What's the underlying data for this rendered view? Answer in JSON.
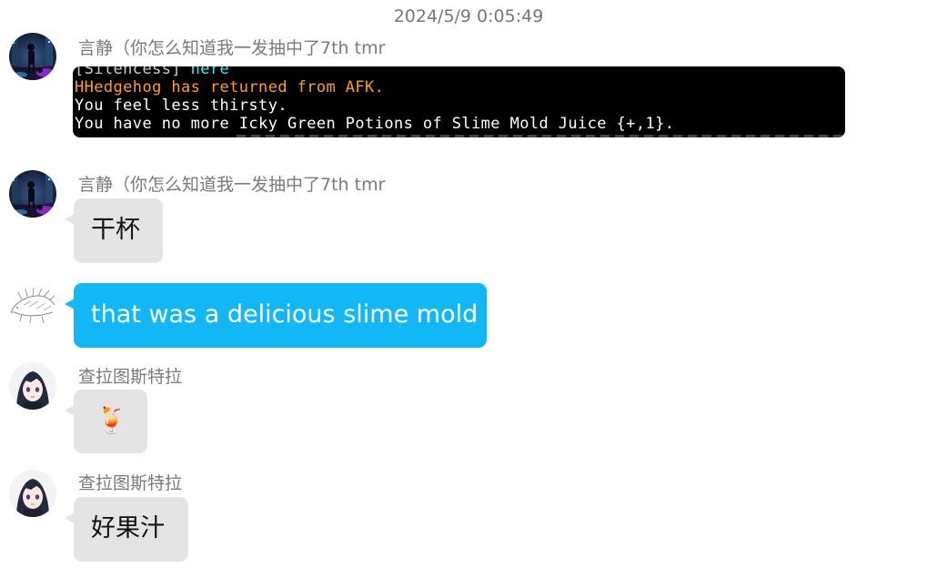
{
  "chat": {
    "timestamp": "2024/5/9 0:05:49",
    "messages": [
      {
        "sender": "言静（你怎么知道我一发抽中了7th tmr",
        "type": "image",
        "image_log": [
          [
            {
              "text": "[Silencess] ",
              "color": "gray"
            },
            {
              "text": "here",
              "color": "cyan"
            }
          ],
          [
            {
              "text": "HHedgehog has returned from AFK.",
              "color": "orange"
            }
          ],
          [
            {
              "text": "You feel less thirsty.",
              "color": "white"
            }
          ],
          [
            {
              "text": "You have no more Icky Green Potions of Slime Mold Juice {+,1}.",
              "color": "white"
            }
          ]
        ]
      },
      {
        "sender": "言静（你怎么知道我一发抽中了7th tmr",
        "text": "干杯"
      },
      {
        "sender": "",
        "text": "that was a delicious slime mold",
        "self": true
      },
      {
        "sender": "查拉图斯特拉",
        "emoji": "🍹",
        "emoji_name": "tropical-drink-icon"
      },
      {
        "sender": "查拉图斯特拉",
        "text": "好果汁"
      }
    ]
  },
  "colors": {
    "self_bubble": "#12b7f5",
    "other_bubble": "#e4e4e4",
    "sender_text": "#7a7a7a",
    "timestamp_text": "#777777",
    "log_background": "#000000",
    "log_orange": "#ff9f1c",
    "log_cyan": "#45e7ff"
  }
}
